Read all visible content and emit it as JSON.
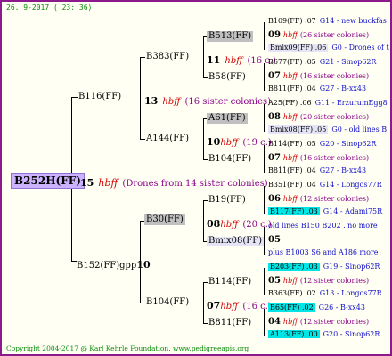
{
  "header": "26. 9-2017 ( 23: 36)",
  "copyright": "Copyright 2004-2017 @ Karl Kehrle Foundation.   www.pedigreeapis.org",
  "root": {
    "label": "B252H(FF)",
    "num": "15",
    "hbff": "hbff",
    "note": "(Drones from 14 sister colonies)"
  },
  "gen1": [
    {
      "label": "B116(FF)",
      "num": "13",
      "hbff": "hbff",
      "note": "(16 sister colonies)"
    },
    {
      "label": "B152(FF)gpp",
      "num": "10"
    }
  ],
  "gen2": [
    {
      "label": "B383(FF)",
      "num": "11",
      "hbff": "hbff",
      "note": "(16 c.)"
    },
    {
      "label": "A144(FF)",
      "num": "10",
      "hbff": "hbff",
      "note": "(19 c.)"
    },
    {
      "label": "B30(FF)",
      "num": "08",
      "hbff": "hbff",
      "note": "(20 c.)"
    },
    {
      "label": "B104(FF)",
      "num": "07",
      "hbff": "hbff",
      "note": "(16 c.)"
    }
  ],
  "gen3": [
    {
      "label": "B513(FF)"
    },
    {
      "label": "B58(FF)"
    },
    {
      "label": "A61(FF)"
    },
    {
      "label": "B104(FF)"
    },
    {
      "label": "B19(FF)"
    },
    {
      "label": "Bmix08(FF)"
    },
    {
      "label": "B114(FF)"
    },
    {
      "label": "B811(FF)"
    }
  ],
  "gen4": [
    {
      "a": "B109(FF) .07",
      "b": "G14 - new buckfas"
    },
    {
      "num": "09",
      "hbff": "hbff",
      "note": "(26 sister colonies)"
    },
    {
      "a": "Bmix09(FF) .06",
      "b": "G0 - Drones of t"
    },
    {
      "a": "B677(FF) .05",
      "b": "G21 - Sinop62R"
    },
    {
      "num": "07",
      "hbff": "hbff",
      "note": "(16 sister colonies)"
    },
    {
      "a": "B811(FF) .04",
      "b": "G27 - B-xx43"
    },
    {
      "a": "A25(FF) .06",
      "b": "G11 - ErzurumEgg8"
    },
    {
      "num": "08",
      "hbff": "hbff",
      "note": "(20 sister colonies)"
    },
    {
      "a": "Bmix08(FF) .05",
      "b": "G0 - old lines B"
    },
    {
      "a": "B114(FF) .05",
      "b": "G20 - Sinop62R"
    },
    {
      "num": "07",
      "hbff": "hbff",
      "note": "(16 sister colonies)"
    },
    {
      "a": "B811(FF) .04",
      "b": "G27 - B-xx43"
    },
    {
      "a": "B351(FF) .04",
      "b": "G14 - Longos77R"
    },
    {
      "num": "06",
      "hbff": "hbff",
      "note": "(12 sister colonies)"
    },
    {
      "a": "B117(FF) .03",
      "b": "G14 - Adami75R"
    },
    {
      "text": "old lines B150 B202 . no more"
    },
    {
      "num": "05",
      "hbff": "",
      "note": ""
    },
    {
      "text": "plus B1003 S6 and A186 more"
    },
    {
      "a": "B203(FF) .03",
      "b": "G19 - Sinop62R"
    },
    {
      "num": "05",
      "hbff": "hbff",
      "note": "(12 sister colonies)"
    },
    {
      "a": "B363(FF) .02",
      "b": "G13 - Longos77R"
    },
    {
      "a": "B65(FF) .02",
      "b": "G26 - B-xx43"
    },
    {
      "num": "04",
      "hbff": "hbff",
      "note": "(12 sister colonies)"
    },
    {
      "a": "A113(FF) .00",
      "b": "G20 - Sinop62R"
    }
  ]
}
